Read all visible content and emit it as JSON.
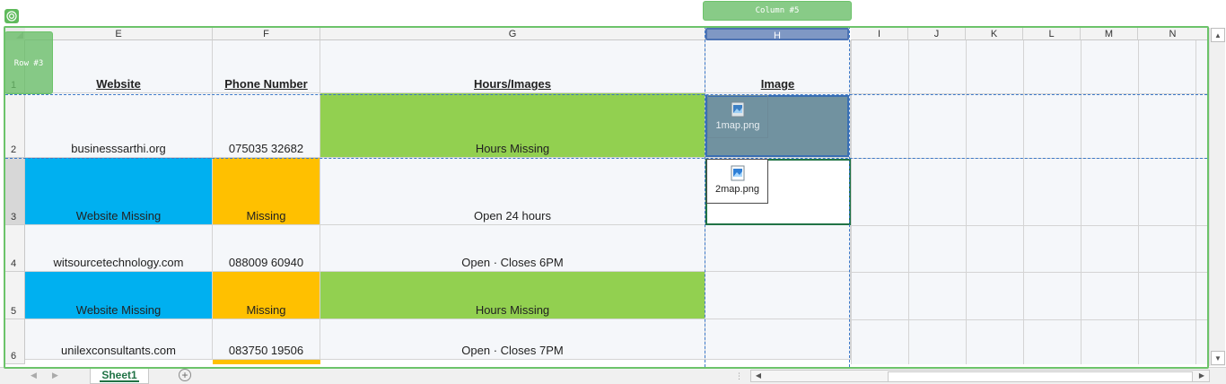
{
  "overlay": {
    "column_tag": "Column #5",
    "row_tag": "Row #3"
  },
  "colors": {
    "green_fill": "#92d050",
    "blue_fill": "#00b0f0",
    "orange_fill": "#ffc000",
    "overlay_green": "#6cc36a",
    "selection_blue": "#3c78c8"
  },
  "column_headers": [
    "E",
    "F",
    "G",
    "H",
    "I",
    "J",
    "K",
    "L",
    "M",
    "N"
  ],
  "selected_column": "H",
  "row_headers": [
    "1",
    "2",
    "3",
    "4",
    "5",
    "6"
  ],
  "rows": [
    {
      "cells": [
        "Website",
        "Phone Number",
        "Hours/Images",
        "Image"
      ]
    },
    {
      "cells": [
        "businesssarthi.org",
        "075035 32682",
        "Hours Missing",
        ""
      ]
    },
    {
      "cells": [
        "Website Missing",
        "Missing",
        "Open 24 hours",
        ""
      ]
    },
    {
      "cells": [
        "witsourcetechnology.com",
        "088009 60940",
        "Open · Closes 6PM",
        ""
      ]
    },
    {
      "cells": [
        "Website Missing",
        "Missing",
        "Hours Missing",
        ""
      ]
    },
    {
      "cells": [
        "unilexconsultants.com",
        "083750 19506",
        "Open · Closes 7PM",
        ""
      ]
    }
  ],
  "images": [
    {
      "label": "1map.png",
      "icon": "image-file-icon"
    },
    {
      "label": "2map.png",
      "icon": "image-file-icon"
    }
  ],
  "sheet_tabs": {
    "active": "Sheet1",
    "add_icon": "plus-circle-icon"
  }
}
